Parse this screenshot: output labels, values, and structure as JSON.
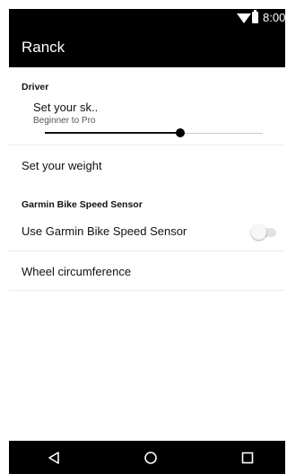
{
  "status_bar": {
    "time": "8:00",
    "icons": [
      "wifi-icon",
      "battery-icon"
    ]
  },
  "app_bar": {
    "title": "Ranck"
  },
  "settings": {
    "driver": {
      "category": "Driver",
      "skill": {
        "title": "Set your sk..",
        "summary": "Beginner to Pro",
        "value_fraction": 0.62
      },
      "weight_label": "Set your weight"
    },
    "sensor": {
      "category": "Garmin Bike Speed Sensor",
      "use_sensor_label": "Use Garmin Bike Speed Sensor",
      "use_sensor_enabled": false,
      "wheel_label": "Wheel circumference"
    }
  },
  "nav_bar": {
    "icons": [
      "back-icon",
      "home-icon",
      "recents-icon"
    ]
  },
  "colors": {
    "bar": "#000000",
    "background": "#ffffff"
  }
}
